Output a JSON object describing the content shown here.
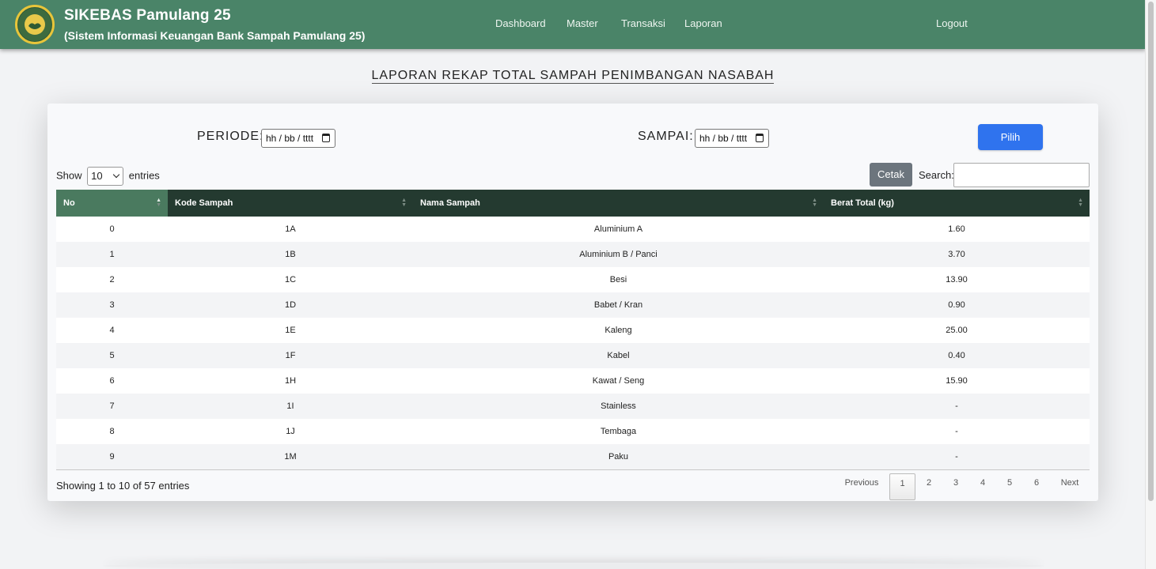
{
  "app": {
    "title": "SIKEBAS Pamulang 25",
    "subtitle": "(Sistem Informasi Keuangan Bank Sampah Pamulang 25)"
  },
  "nav": {
    "items": [
      "Dashboard",
      "Master",
      "Transaksi",
      "Laporan"
    ],
    "logout": "Logout"
  },
  "page": {
    "title": "LAPORAN REKAP TOTAL SAMPAH PENIMBANGAN NASABAH"
  },
  "filter": {
    "periode_label": "PERIODE:",
    "sampai_label": "SAMPAI:",
    "date_placeholder": "hh / bb / tttt",
    "pilih_label": "Pilih"
  },
  "datatable": {
    "show_label": "Show",
    "page_length": "10",
    "entries_label": "entries",
    "cetak_label": "Cetak",
    "search_label": "Search:",
    "search_value": "",
    "columns": [
      "No",
      "Kode Sampah",
      "Nama Sampah",
      "Berat Total (kg)"
    ],
    "rows": [
      [
        "0",
        "1A",
        "Aluminium A",
        "1.60"
      ],
      [
        "1",
        "1B",
        "Aluminium B / Panci",
        "3.70"
      ],
      [
        "2",
        "1C",
        "Besi",
        "13.90"
      ],
      [
        "3",
        "1D",
        "Babet / Kran",
        "0.90"
      ],
      [
        "4",
        "1E",
        "Kaleng",
        "25.00"
      ],
      [
        "5",
        "1F",
        "Kabel",
        "0.40"
      ],
      [
        "6",
        "1H",
        "Kawat / Seng",
        "15.90"
      ],
      [
        "7",
        "1I",
        "Stainless",
        "-"
      ],
      [
        "8",
        "1J",
        "Tembaga",
        "-"
      ],
      [
        "9",
        "1M",
        "Paku",
        "-"
      ]
    ],
    "info": "Showing 1 to 10 of 57 entries",
    "pagination": {
      "previous": "Previous",
      "pages": [
        "1",
        "2",
        "3",
        "4",
        "5",
        "6"
      ],
      "current": "1",
      "next": "Next"
    }
  },
  "colors": {
    "navbar": "#4a8468",
    "table_header": "#243a30",
    "table_header_sorted": "#4a7a5f",
    "primary_button": "#2f73ee",
    "secondary_button": "#6c757d"
  }
}
